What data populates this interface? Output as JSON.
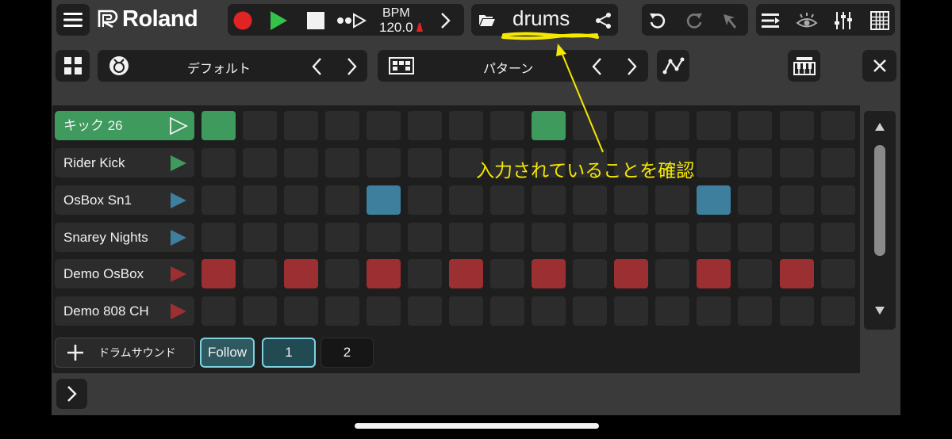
{
  "header": {
    "brand": "Roland",
    "bpm_label": "BPM",
    "bpm_value": "120.0",
    "song_name": "drums"
  },
  "toolbar2": {
    "kit_name": "デフォルト",
    "pattern_name": "パターン"
  },
  "tracks": [
    {
      "name": "キック 26",
      "color": "#3f9a5e",
      "selected": true,
      "pattern": [
        1,
        0,
        0,
        0,
        0,
        0,
        0,
        0,
        1,
        0,
        0,
        0,
        0,
        0,
        0,
        0
      ]
    },
    {
      "name": "Rider Kick",
      "color": "#3f9a5e",
      "selected": false,
      "pattern": [
        0,
        0,
        0,
        0,
        0,
        0,
        0,
        0,
        0,
        0,
        0,
        0,
        0,
        0,
        0,
        0
      ]
    },
    {
      "name": "OsBox Sn1",
      "color": "#3d7f9c",
      "selected": false,
      "pattern": [
        0,
        0,
        0,
        0,
        1,
        0,
        0,
        0,
        0,
        0,
        0,
        0,
        1,
        0,
        0,
        0
      ]
    },
    {
      "name": "Snarey Nights",
      "color": "#3d7f9c",
      "selected": false,
      "pattern": [
        0,
        0,
        0,
        0,
        0,
        0,
        0,
        0,
        0,
        0,
        0,
        0,
        0,
        0,
        0,
        0
      ]
    },
    {
      "name": "Demo OsBox",
      "color": "#9b2f31",
      "selected": false,
      "pattern": [
        1,
        0,
        1,
        0,
        1,
        0,
        1,
        0,
        1,
        0,
        1,
        0,
        1,
        0,
        1,
        0
      ]
    },
    {
      "name": "Demo 808 CH",
      "color": "#9b2f31",
      "selected": false,
      "pattern": [
        0,
        0,
        0,
        0,
        0,
        0,
        0,
        0,
        0,
        0,
        0,
        0,
        0,
        0,
        0,
        0
      ]
    }
  ],
  "bottom": {
    "add_sound_label": "ドラムサウンド",
    "follow_label": "Follow",
    "page1_label": "1",
    "page2_label": "2"
  },
  "annotation": {
    "text": "入力されていることを確認",
    "color": "#f5e800"
  },
  "colors": {
    "record": "#e02424",
    "play": "#35c24b",
    "active_outline": "#7fd3e0"
  }
}
